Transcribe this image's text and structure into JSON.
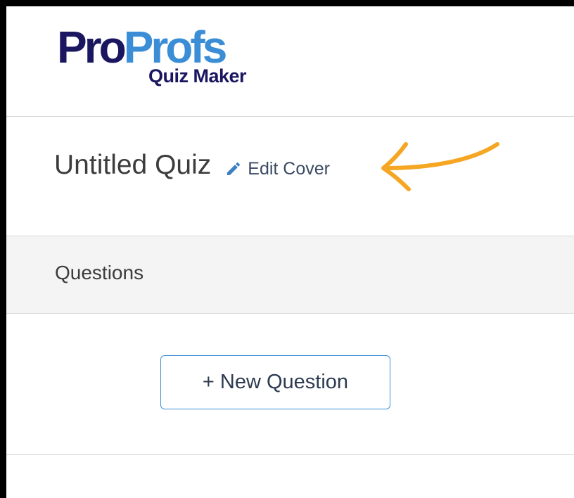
{
  "brand": {
    "logo_part1": "Pro",
    "logo_part2": "Profs",
    "product": "Quiz Maker",
    "colors": {
      "dark": "#1a1660",
      "light": "#3b8ed6"
    }
  },
  "quiz": {
    "title": "Untitled Quiz",
    "edit_cover_label": "Edit Cover",
    "edit_icon": "pencil-icon"
  },
  "annotation": {
    "arrow_color": "#f5a623"
  },
  "questions": {
    "header": "Questions",
    "new_question_label": "+ New Question"
  }
}
